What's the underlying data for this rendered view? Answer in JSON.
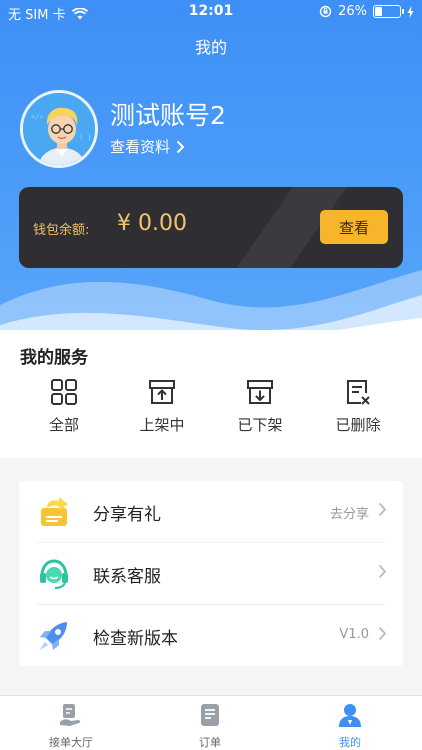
{
  "status_bar": {
    "carrier": "无 SIM 卡",
    "time": "12:01",
    "battery": "26%",
    "battery_level": 0.26
  },
  "header": {
    "title": "我的"
  },
  "profile": {
    "username": "测试账号2",
    "view_profile": "查看资料"
  },
  "wallet": {
    "label": "钱包余额:",
    "amount": "¥ 0.00",
    "button": "查看"
  },
  "services": {
    "title": "我的服务",
    "items": [
      {
        "label": "全部",
        "icon": "grid-icon"
      },
      {
        "label": "上架中",
        "icon": "box-up-icon"
      },
      {
        "label": "已下架",
        "icon": "box-down-icon"
      },
      {
        "label": "已删除",
        "icon": "deleted-doc-icon"
      }
    ]
  },
  "menu": [
    {
      "label": "分享有礼",
      "value": "去分享",
      "icon": "share-gift-icon"
    },
    {
      "label": "联系客服",
      "value": "",
      "icon": "customer-service-icon"
    },
    {
      "label": "检查新版本",
      "value": "V1.0",
      "icon": "rocket-icon"
    }
  ],
  "tabbar": [
    {
      "label": "接单大厅",
      "icon": "hall-icon"
    },
    {
      "label": "订单",
      "icon": "order-icon"
    },
    {
      "label": "我的",
      "icon": "profile-icon"
    }
  ],
  "colors": {
    "primary": "#3d8ef5",
    "wallet_bg": "#2f2f33",
    "wallet_gold": "#f2c46b",
    "button_orange": "#f7b52c"
  }
}
